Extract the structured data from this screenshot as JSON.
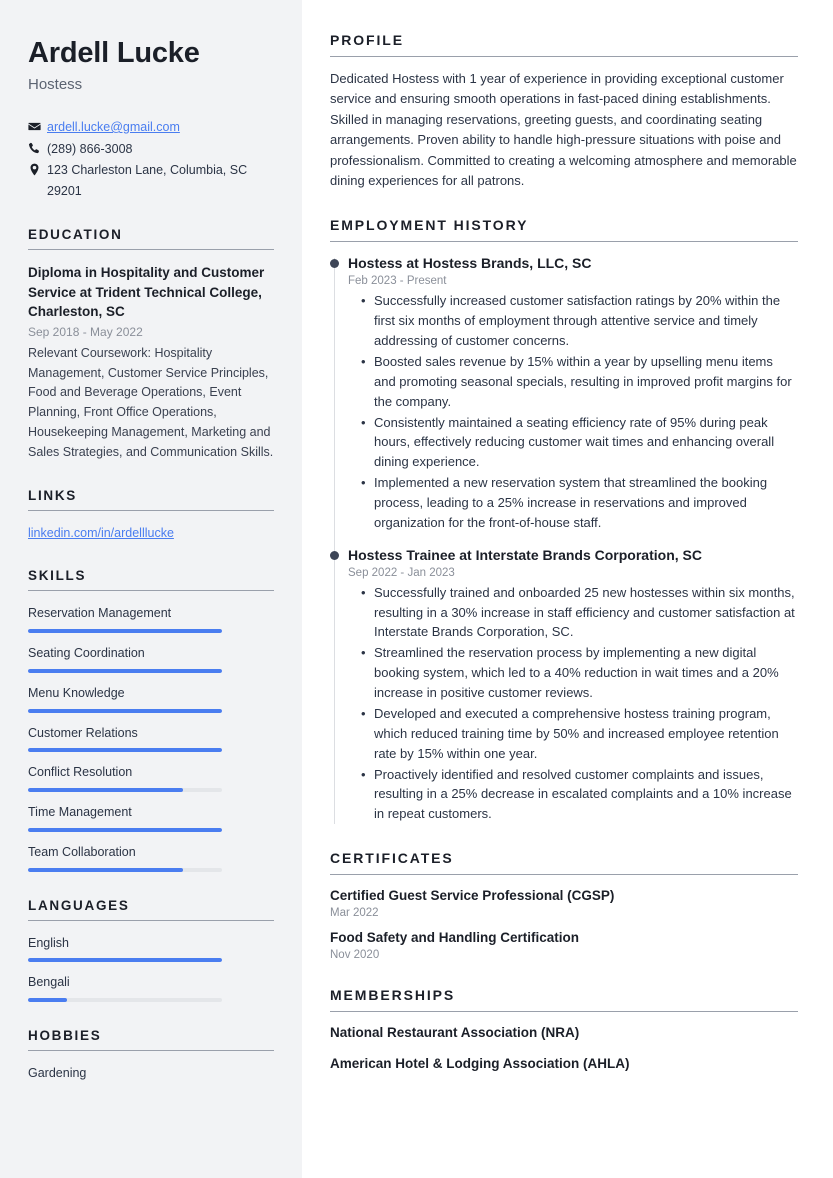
{
  "theme": {
    "sidebar_bg": "#f2f3f5",
    "accent": "#4a7df0",
    "heading_color": "#1b1f28",
    "muted_color": "#8a8f99",
    "rule_color": "#9aa0ab",
    "timeline_dot": "#3e4657"
  },
  "header": {
    "name": "Ardell Lucke",
    "job_title": "Hostess",
    "contact": [
      {
        "icon": "envelope-icon",
        "text": "ardell.lucke@gmail.com",
        "is_link": true
      },
      {
        "icon": "phone-icon",
        "text": "(289) 866-3008",
        "is_link": false
      },
      {
        "icon": "location-pin-icon",
        "text": "123 Charleston Lane, Columbia, SC 29201",
        "is_link": false
      }
    ]
  },
  "sidebar": {
    "education": {
      "heading": "EDUCATION",
      "items": [
        {
          "title": "Diploma in Hospitality and Customer Service at Trident Technical College, Charleston, SC",
          "date": "Sep 2018 - May 2022",
          "description": "Relevant Coursework: Hospitality Management, Customer Service Principles, Food and Beverage Operations, Event Planning, Front Office Operations, Housekeeping Management, Marketing and Sales Strategies, and Communication Skills."
        }
      ]
    },
    "links": {
      "heading": "LINKS",
      "items": [
        {
          "label": "linkedin.com/in/ardelllucke"
        }
      ]
    },
    "skills": {
      "heading": "SKILLS",
      "items": [
        {
          "label": "Reservation Management",
          "level": 100
        },
        {
          "label": "Seating Coordination",
          "level": 100
        },
        {
          "label": "Menu Knowledge",
          "level": 100
        },
        {
          "label": "Customer Relations",
          "level": 100
        },
        {
          "label": "Conflict Resolution",
          "level": 80
        },
        {
          "label": "Time Management",
          "level": 100
        },
        {
          "label": "Team Collaboration",
          "level": 80
        }
      ]
    },
    "languages": {
      "heading": "LANGUAGES",
      "items": [
        {
          "label": "English",
          "level": 100
        },
        {
          "label": "Bengali",
          "level": 20
        }
      ]
    },
    "hobbies": {
      "heading": "HOBBIES",
      "items": [
        {
          "label": "Gardening"
        }
      ]
    }
  },
  "main": {
    "profile": {
      "heading": "PROFILE",
      "text": "Dedicated Hostess with 1 year of experience in providing exceptional customer service and ensuring smooth operations in fast-paced dining establishments. Skilled in managing reservations, greeting guests, and coordinating seating arrangements. Proven ability to handle high-pressure situations with poise and professionalism. Committed to creating a welcoming atmosphere and memorable dining experiences for all patrons."
    },
    "employment": {
      "heading": "EMPLOYMENT HISTORY",
      "jobs": [
        {
          "title": "Hostess at Hostess Brands, LLC, SC",
          "date": "Feb 2023 - Present",
          "bullets": [
            "Successfully increased customer satisfaction ratings by 20% within the first six months of employment through attentive service and timely addressing of customer concerns.",
            "Boosted sales revenue by 15% within a year by upselling menu items and promoting seasonal specials, resulting in improved profit margins for the company.",
            "Consistently maintained a seating efficiency rate of 95% during peak hours, effectively reducing customer wait times and enhancing overall dining experience.",
            "Implemented a new reservation system that streamlined the booking process, leading to a 25% increase in reservations and improved organization for the front-of-house staff."
          ]
        },
        {
          "title": "Hostess Trainee at Interstate Brands Corporation, SC",
          "date": "Sep 2022 - Jan 2023",
          "bullets": [
            "Successfully trained and onboarded 25 new hostesses within six months, resulting in a 30% increase in staff efficiency and customer satisfaction at Interstate Brands Corporation, SC.",
            "Streamlined the reservation process by implementing a new digital booking system, which led to a 40% reduction in wait times and a 20% increase in positive customer reviews.",
            "Developed and executed a comprehensive hostess training program, which reduced training time by 50% and increased employee retention rate by 15% within one year.",
            "Proactively identified and resolved customer complaints and issues, resulting in a 25% decrease in escalated complaints and a 10% increase in repeat customers."
          ]
        }
      ]
    },
    "certificates": {
      "heading": "CERTIFICATES",
      "items": [
        {
          "name": "Certified Guest Service Professional (CGSP)",
          "date": "Mar 2022"
        },
        {
          "name": "Food Safety and Handling Certification",
          "date": "Nov 2020"
        }
      ]
    },
    "memberships": {
      "heading": "MEMBERSHIPS",
      "items": [
        {
          "name": "National Restaurant Association (NRA)"
        },
        {
          "name": "American Hotel & Lodging Association (AHLA)"
        }
      ]
    }
  }
}
